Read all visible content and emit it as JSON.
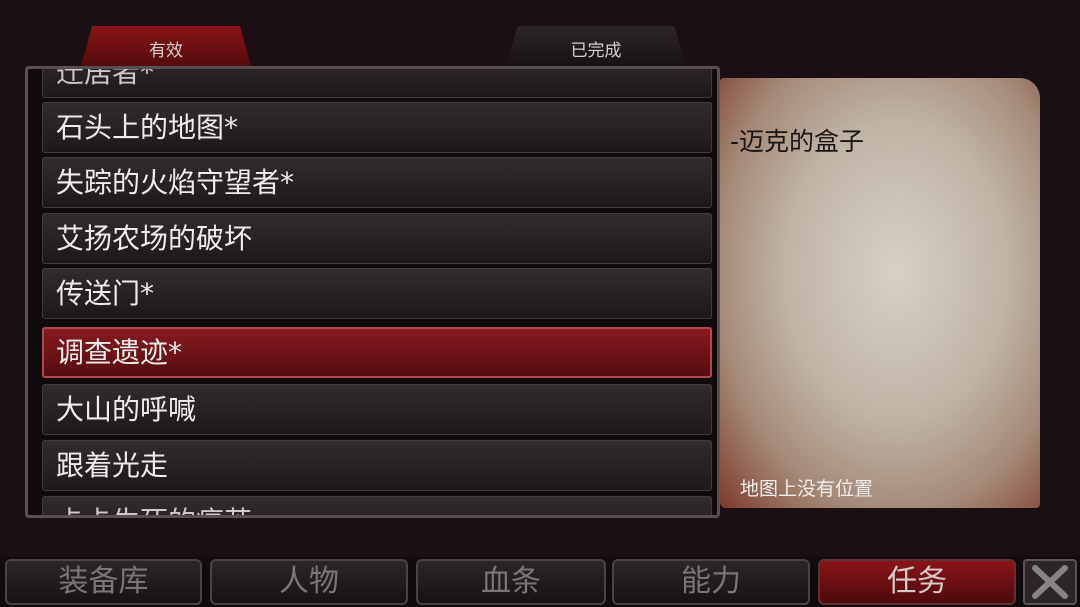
{
  "tabs": {
    "active": "有效",
    "completed": "已完成"
  },
  "quests": [
    "迁居者*",
    "石头上的地图*",
    "失踪的火焰守望者*",
    "艾扬农场的破坏",
    "传送门*",
    "调查遗迹*",
    "大山的呼喊",
    "跟着光走",
    "卡卡生死的痛苦"
  ],
  "selected_index": 5,
  "detail": {
    "title": "-迈克的盒子",
    "note": "地图上没有位置"
  },
  "nav": [
    "装备库",
    "人物",
    "血条",
    "能力",
    "任务"
  ],
  "nav_active_index": 4,
  "colors": {
    "accent": "#8b1418",
    "background": "#1a0f12"
  },
  "icons": {
    "close": "close-icon"
  }
}
